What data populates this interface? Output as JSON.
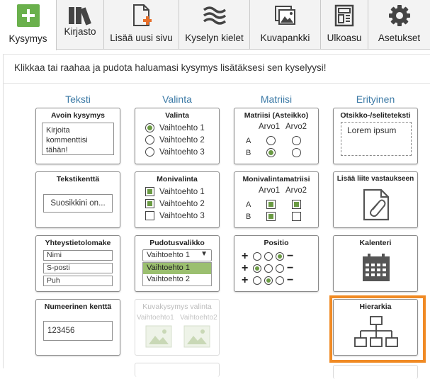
{
  "toolbar": {
    "items": [
      {
        "label": "Kysymys",
        "icon": "plus-icon",
        "active": true
      },
      {
        "label": "Kirjasto",
        "icon": "books-icon"
      },
      {
        "label": "Lisää uusi sivu",
        "icon": "add-page-icon"
      },
      {
        "label": "Kyselyn kielet",
        "icon": "waves-icon"
      },
      {
        "label": "Kuvapankki",
        "icon": "image-bank-icon"
      },
      {
        "label": "Ulkoasu",
        "icon": "layout-icon"
      },
      {
        "label": "Asetukset",
        "icon": "gear-icon"
      }
    ]
  },
  "panel": {
    "hint": "Klikkaa tai raahaa ja pudota haluamasi kysymys lisätäksesi sen kyselyysi!",
    "columns": [
      "Teksti",
      "Valinta",
      "Matriisi",
      "Erityinen"
    ]
  },
  "cards": {
    "open_question": {
      "title": "Avoin kysymys",
      "placeholder": "Kirjoita kommenttisi tähän!"
    },
    "single_choice": {
      "title": "Valinta",
      "options": [
        "Vaihtoehto 1",
        "Vaihtoehto 2",
        "Vaihtoehto 3"
      ],
      "selected_index": 0
    },
    "matrix_scale": {
      "title": "Matriisi (Asteikko)",
      "cols": [
        "Arvo1",
        "Arvo2"
      ],
      "rows": [
        "A",
        "B"
      ]
    },
    "heading_text": {
      "title": "Otsikko-/seliteteksti",
      "sample": "Lorem ipsum"
    },
    "text_field": {
      "title": "Tekstikenttä",
      "value": "Suosikkini on..."
    },
    "multi_choice": {
      "title": "Monivalinta",
      "options": [
        "Vaihtoehto 1",
        "Vaihtoehto 2",
        "Vaihtoehto 3"
      ],
      "checked": [
        true,
        true,
        false
      ]
    },
    "multi_matrix": {
      "title": "Monivalintamatriisi",
      "cols": [
        "Arvo1",
        "Arvo2"
      ],
      "rows": [
        "A",
        "B"
      ]
    },
    "attachment": {
      "title": "Lisää liite vastaukseen",
      "icon": "paperclip-document-icon"
    },
    "contact_form": {
      "title": "Yhteystietolomake",
      "fields": [
        "Nimi",
        "S-posti",
        "Puh"
      ]
    },
    "dropdown": {
      "title": "Pudotusvalikko",
      "selected": "Vaihtoehto 1",
      "options": [
        "Vaihtoehto 1",
        "Vaihtoehto 2"
      ]
    },
    "position": {
      "title": "Positio"
    },
    "calendar": {
      "title": "Kalenteri",
      "icon": "calendar-icon"
    },
    "numeric_field": {
      "title": "Numeerinen kenttä",
      "value": "123456"
    },
    "image_choice": {
      "title": "Kuvakysymys valinta",
      "options": [
        "Vaihtoehto1",
        "Vaihtoehto2"
      ]
    },
    "hierarchy": {
      "title": "Hierarkia",
      "icon": "org-chart-icon"
    }
  },
  "colors": {
    "accent_green": "#6ab04c",
    "heading_blue": "#3c7aa6",
    "highlight_orange": "#f08a24"
  }
}
